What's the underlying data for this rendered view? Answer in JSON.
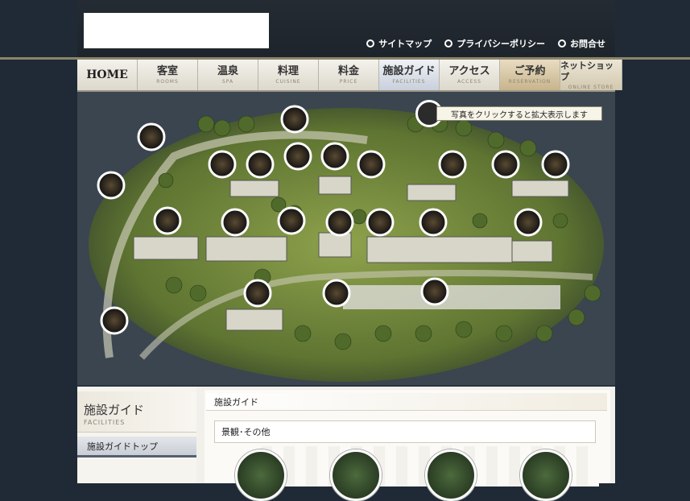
{
  "header": {
    "top_links": [
      "サイトマップ",
      "プライバシーポリシー",
      "お問合せ"
    ]
  },
  "nav": {
    "home": "HOME",
    "items": [
      {
        "jp": "客室",
        "en": "ROOMS"
      },
      {
        "jp": "温泉",
        "en": "SPA"
      },
      {
        "jp": "料理",
        "en": "CUISINE"
      },
      {
        "jp": "料金",
        "en": "PRICE"
      },
      {
        "jp": "施設ガイド",
        "en": "FACILITIES"
      },
      {
        "jp": "アクセス",
        "en": "ACCESS"
      },
      {
        "jp": "ご予約",
        "en": "RESERVATION"
      },
      {
        "jp": "ネットショップ",
        "en": "ONLINE STORE"
      }
    ]
  },
  "map": {
    "hint": "写真をクリックすると拡大表示します"
  },
  "sidebar": {
    "title_jp": "施設ガイド",
    "title_en": "FACILITIES",
    "top_link": "施設ガイドトップ"
  },
  "main": {
    "title": "施設ガイド",
    "section": "景観･その他"
  },
  "colors": {
    "background": "#1f2a36",
    "accent_gold": "#8c846a",
    "map_green": "#6f8a3c"
  }
}
